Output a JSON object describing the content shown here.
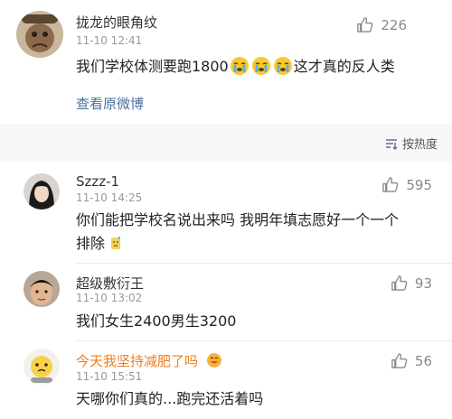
{
  "top_comment": {
    "username": "拢龙的眼角纹",
    "timestamp": "11-10 12:41",
    "text_before": "我们学校体测要跑1800",
    "text_after": "这才真的反人类",
    "emoji": "crying-face-icon",
    "likes": "226",
    "view_original": "查看原微博"
  },
  "sort": {
    "label": "按热度"
  },
  "comments": [
    {
      "username": "Szzz-1",
      "timestamp": "11-10 14:25",
      "likes": "595",
      "line1": "你们能把学校名说出来吗 我明年填志愿好一个一个",
      "line2": "排除"
    },
    {
      "username": "超级敷衍王",
      "timestamp": "11-10 13:02",
      "likes": "93",
      "line1": "我们女生2400男生3200"
    },
    {
      "username": "今天我坚持减肥了吗",
      "timestamp": "11-10 15:51",
      "likes": "56",
      "line1": "天哪你们真的...跑完还活着吗"
    }
  ],
  "colors": {
    "link": "#4a6fa0",
    "vip_name": "#f07d1a",
    "meta": "#9a9a9a"
  }
}
